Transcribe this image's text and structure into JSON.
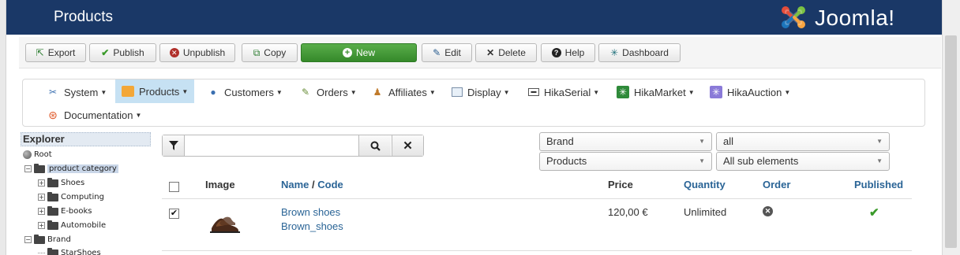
{
  "header": {
    "title": "Products",
    "logo_text": "Joomla!"
  },
  "toolbar": {
    "export": "Export",
    "publish": "Publish",
    "unpublish": "Unpublish",
    "copy": "Copy",
    "new": "New",
    "edit": "Edit",
    "delete": "Delete",
    "help": "Help",
    "dashboard": "Dashboard"
  },
  "menu": {
    "system": "System",
    "products": "Products",
    "customers": "Customers",
    "orders": "Orders",
    "affiliates": "Affiliates",
    "display": "Display",
    "hikaserial": "HikaSerial",
    "hikamarket": "HikaMarket",
    "hikaauction": "HikaAuction",
    "documentation": "Documentation"
  },
  "explorer": {
    "title": "Explorer",
    "root": "Root",
    "product_category": "product category",
    "shoes": "Shoes",
    "computing": "Computing",
    "ebooks": "E-books",
    "automobile": "Automobile",
    "brand": "Brand",
    "starshoes": "StarShoes"
  },
  "search": {
    "value": "",
    "placeholder": ""
  },
  "filters": {
    "brand": "Brand",
    "all": "all",
    "products": "Products",
    "sub_elements": "All sub elements"
  },
  "table": {
    "headers": {
      "image": "Image",
      "name": "Name",
      "slash": " / ",
      "code": "Code",
      "price": "Price",
      "quantity": "Quantity",
      "order": "Order",
      "published": "Published"
    },
    "rows": [
      {
        "name": "Brown shoes",
        "code": "Brown_shoes",
        "price": "120,00 €",
        "quantity": "Unlimited",
        "checked": true,
        "published": true
      }
    ]
  },
  "colors": {
    "header_bg": "#1a3867",
    "new_button": "#3b8f2f",
    "link": "#2a6496",
    "active_menu": "#c6e1f3"
  }
}
